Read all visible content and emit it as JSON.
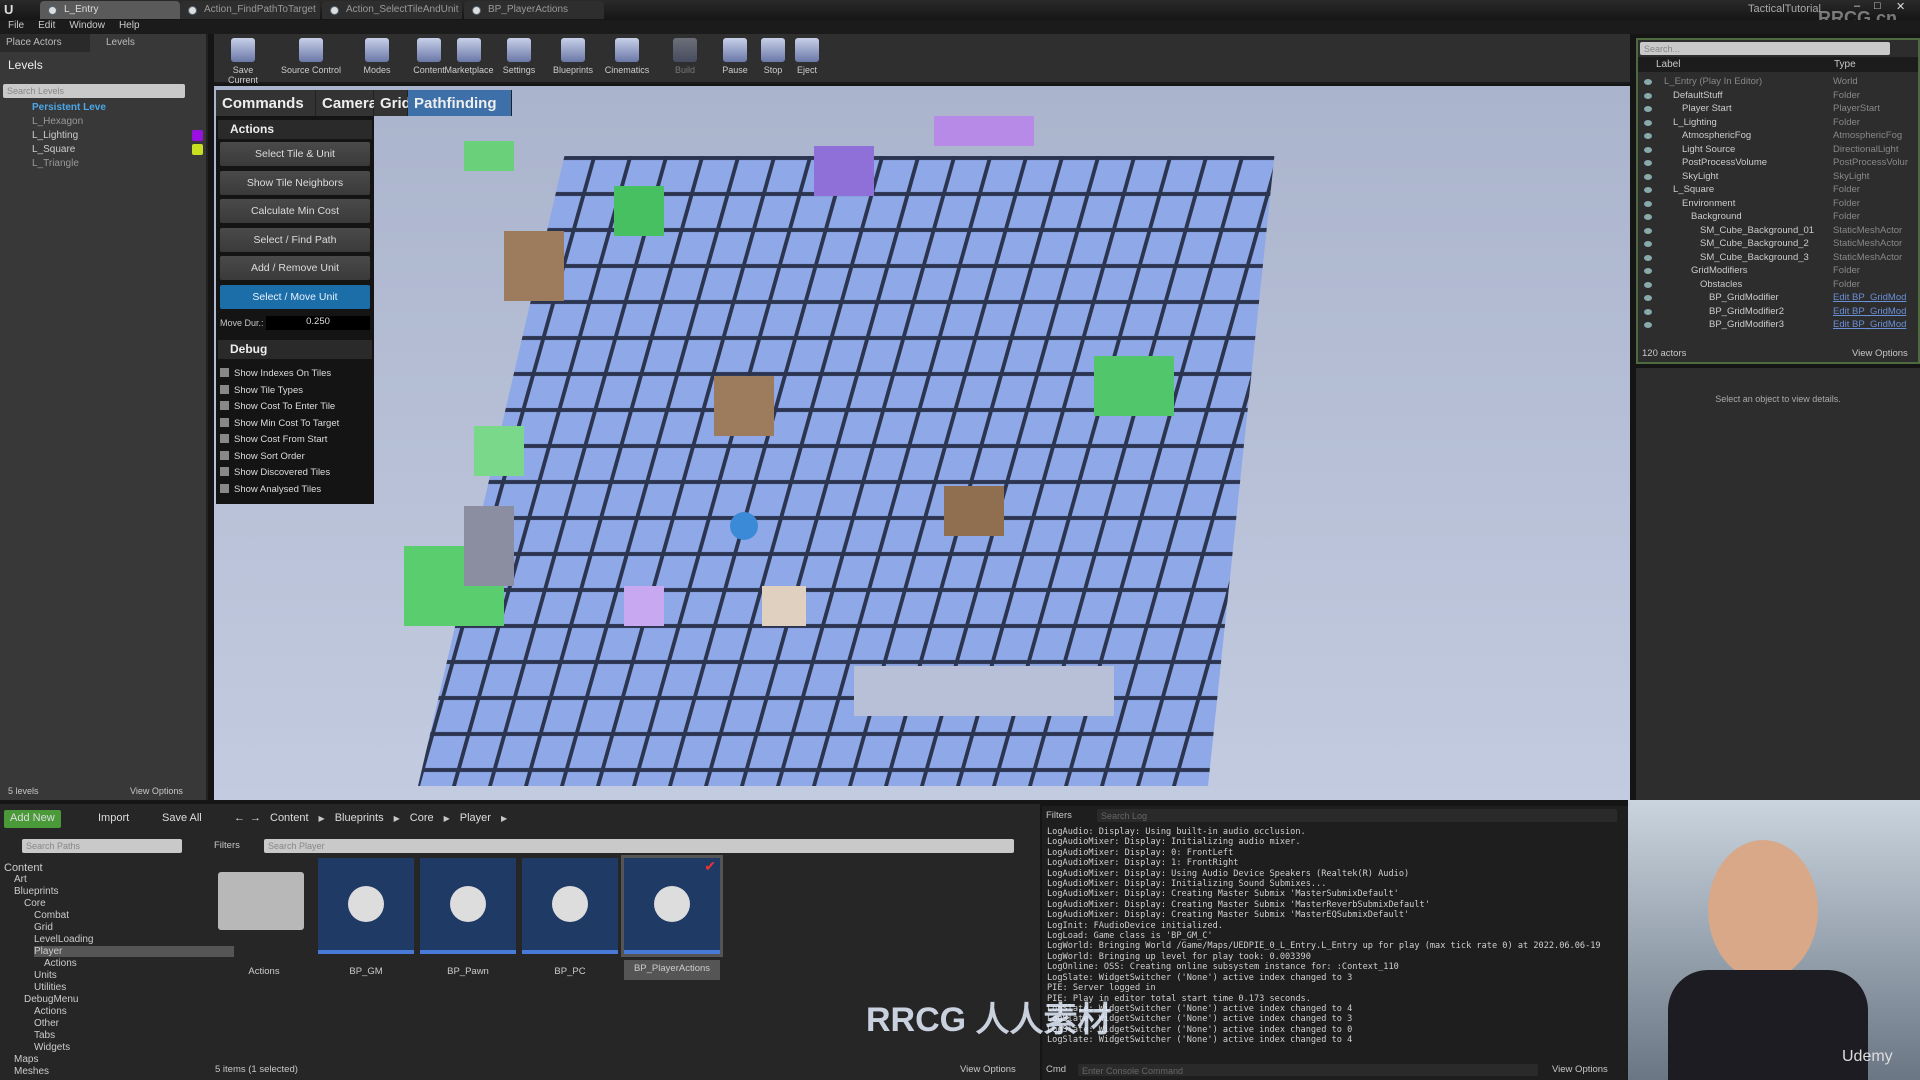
{
  "window": {
    "tabs": [
      {
        "label": "L_Entry",
        "active": true
      },
      {
        "label": "Action_FindPathToTarget"
      },
      {
        "label": "Action_SelectTileAndUnit"
      },
      {
        "label": "BP_PlayerActions"
      }
    ],
    "project": "TacticalTutorial",
    "watermark": "RRCG.cn"
  },
  "menu": [
    "File",
    "Edit",
    "Window",
    "Help"
  ],
  "left_panel": {
    "tabs": [
      "Place Actors",
      "Levels"
    ],
    "title": "Levels",
    "search_placeholder": "Search Levels",
    "levels": [
      {
        "name": "Persistent Leve",
        "color": ""
      },
      {
        "name": "L_Hexagon",
        "color": ""
      },
      {
        "name": "L_Lighting",
        "color": "#9a10e0"
      },
      {
        "name": "L_Square",
        "color": "#c8e020"
      },
      {
        "name": "L_Triangle",
        "color": ""
      }
    ],
    "count": "5 levels",
    "view_options": "View Options"
  },
  "toolbar": [
    "Save Current",
    "Source Control",
    "Modes",
    "Content",
    "Marketplace",
    "Settings",
    "Blueprints",
    "Cinematics",
    "Build",
    "Pause",
    "Stop",
    "Eject"
  ],
  "debug_menu": {
    "tabs": [
      "Commands",
      "Camera",
      "Grid",
      "Pathfinding"
    ],
    "selected_tab": "Pathfinding",
    "actions_title": "Actions",
    "actions": [
      "Select Tile & Unit",
      "Show Tile Neighbors",
      "Calculate Min Cost",
      "Select / Find Path",
      "Add / Remove Unit",
      "Select / Move Unit"
    ],
    "selected_action": "Select / Move Unit",
    "move_dur_label": "Move Dur.:",
    "move_dur_value": "0.250",
    "debug_title": "Debug",
    "debug_options": [
      "Show Indexes On Tiles",
      "Show Tile Types",
      "Show Cost To Enter Tile",
      "Show Min Cost To Target",
      "Show Cost From Start",
      "Show Sort Order",
      "Show Discovered Tiles",
      "Show Analysed Tiles"
    ]
  },
  "outliner": {
    "search_placeholder": "Search...",
    "col_label": "Label",
    "col_type": "Type",
    "rows": [
      {
        "label": "L_Entry (Play In Editor)",
        "type": "World",
        "depth": 0
      },
      {
        "label": "DefaultStuff",
        "type": "Folder",
        "depth": 1
      },
      {
        "label": "Player Start",
        "type": "PlayerStart",
        "depth": 2
      },
      {
        "label": "L_Lighting",
        "type": "Folder",
        "depth": 1
      },
      {
        "label": "AtmosphericFog",
        "type": "AtmosphericFog",
        "depth": 2
      },
      {
        "label": "Light Source",
        "type": "DirectionalLight",
        "depth": 2
      },
      {
        "label": "PostProcessVolume",
        "type": "PostProcessVolur",
        "depth": 2
      },
      {
        "label": "SkyLight",
        "type": "SkyLight",
        "depth": 2
      },
      {
        "label": "L_Square",
        "type": "Folder",
        "depth": 1
      },
      {
        "label": "Environment",
        "type": "Folder",
        "depth": 2
      },
      {
        "label": "Background",
        "type": "Folder",
        "depth": 3
      },
      {
        "label": "SM_Cube_Background_01",
        "type": "StaticMeshActor",
        "depth": 4
      },
      {
        "label": "SM_Cube_Background_2",
        "type": "StaticMeshActor",
        "depth": 4
      },
      {
        "label": "SM_Cube_Background_3",
        "type": "StaticMeshActor",
        "depth": 4
      },
      {
        "label": "GridModifiers",
        "type": "Folder",
        "depth": 3
      },
      {
        "label": "Obstacles",
        "type": "Folder",
        "depth": 4
      },
      {
        "label": "BP_GridModifier",
        "type": "Edit BP_GridMod",
        "depth": 5,
        "link": true
      },
      {
        "label": "BP_GridModifier2",
        "type": "Edit BP_GridMod",
        "depth": 5,
        "link": true
      },
      {
        "label": "BP_GridModifier3",
        "type": "Edit BP_GridMod",
        "depth": 5,
        "link": true
      }
    ],
    "count": "120 actors",
    "view_options": "View Options"
  },
  "details": {
    "empty_text": "Select an object to view details."
  },
  "content_browser": {
    "add_new": "Add New",
    "import": "Import",
    "save_all": "Save All",
    "breadcrumb": [
      "Content",
      "Blueprints",
      "Core",
      "Player"
    ],
    "search_paths_placeholder": "Search Paths",
    "filters": "Filters",
    "search_placeholder": "Search Player",
    "tree": [
      {
        "label": "Content",
        "depth": 0
      },
      {
        "label": "Art",
        "depth": 1
      },
      {
        "label": "Blueprints",
        "depth": 1
      },
      {
        "label": "Core",
        "depth": 2
      },
      {
        "label": "Combat",
        "depth": 3
      },
      {
        "label": "Grid",
        "depth": 3
      },
      {
        "label": "LevelLoading",
        "depth": 3
      },
      {
        "label": "Player",
        "depth": 3,
        "selected": true
      },
      {
        "label": "Actions",
        "depth": 4
      },
      {
        "label": "Units",
        "depth": 3
      },
      {
        "label": "Utilities",
        "depth": 3
      },
      {
        "label": "DebugMenu",
        "depth": 2
      },
      {
        "label": "Actions",
        "depth": 3
      },
      {
        "label": "Other",
        "depth": 3
      },
      {
        "label": "Tabs",
        "depth": 3
      },
      {
        "label": "Widgets",
        "depth": 3
      },
      {
        "label": "Maps",
        "depth": 1
      },
      {
        "label": "Meshes",
        "depth": 1
      }
    ],
    "assets": [
      {
        "name": "Actions",
        "kind": "folder"
      },
      {
        "name": "BP_GM",
        "kind": "gamemode"
      },
      {
        "name": "BP_Pawn",
        "kind": "pawn"
      },
      {
        "name": "BP_PC",
        "kind": "controller"
      },
      {
        "name": "BP_PlayerActions",
        "kind": "actor",
        "selected": true
      }
    ],
    "status": "5 items (1 selected)",
    "view_options": "View Options"
  },
  "output_log": {
    "filters": "Filters",
    "search_placeholder": "Search Log",
    "lines": [
      "LogAudio: Display: Using built-in audio occlusion.",
      "LogAudioMixer: Display: Initializing audio mixer.",
      "LogAudioMixer: Display: 0: FrontLeft",
      "LogAudioMixer: Display: 1: FrontRight",
      "LogAudioMixer: Display: Using Audio Device Speakers (Realtek(R) Audio)",
      "LogAudioMixer: Display: Initializing Sound Submixes...",
      "LogAudioMixer: Display: Creating Master Submix 'MasterSubmixDefault'",
      "LogAudioMixer: Display: Creating Master Submix 'MasterReverbSubmixDefault'",
      "LogAudioMixer: Display: Creating Master Submix 'MasterEQSubmixDefault'",
      "LogInit: FAudioDevice initialized.",
      "LogLoad: Game class is 'BP_GM_C'",
      "LogWorld: Bringing World /Game/Maps/UEDPIE_0_L_Entry.L_Entry up for play (max tick rate 0) at 2022.06.06-19",
      "LogWorld: Bringing up level for play took: 0.003390",
      "LogOnline: OSS: Creating online subsystem instance for: :Context_110",
      "LogSlate: WidgetSwitcher ('None') active index changed to 3",
      "PIE: Server logged in",
      "PIE: Play in editor total start time 0.173 seconds.",
      "LogSlate: WidgetSwitcher ('None') active index changed to 4",
      "LogSlate: WidgetSwitcher ('None') active index changed to 3",
      "LogSlate: WidgetSwitcher ('None') active index changed to 0",
      "LogSlate: WidgetSwitcher ('None') active index changed to 4"
    ],
    "cmd": "Cmd",
    "cmd_placeholder": "Enter Console Command",
    "view_options": "View Options"
  },
  "overlay": {
    "watermark": "RRCG 人人素材",
    "udemy": "Udemy"
  }
}
